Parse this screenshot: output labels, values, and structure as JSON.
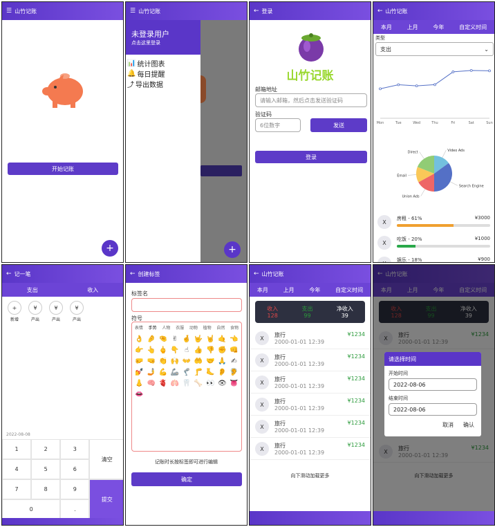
{
  "screen1": {
    "title": "山竹记账",
    "start_label": "开始记账",
    "fab": "+"
  },
  "screen2": {
    "title": "山竹记账",
    "user": "未登录用户",
    "hint": "点击这里登录",
    "menu": [
      {
        "label": "统计图表"
      },
      {
        "label": "每日提醒"
      },
      {
        "label": "导出数据"
      }
    ],
    "fab": "+"
  },
  "screen3": {
    "title": "登录",
    "brand": "山竹记账",
    "email_label": "邮箱地址",
    "email_placeholder": "请输入邮箱，然后点击发送验证码",
    "code_label": "验证码",
    "code_placeholder": "6位数字",
    "send_label": "发送",
    "login_label": "登录"
  },
  "screen4": {
    "title": "山竹记账",
    "tabs": [
      "本月",
      "上月",
      "今年",
      "自定义时间"
    ],
    "type_label": "类型",
    "type_value": "支出",
    "line": {
      "x": [
        "Mon",
        "Tue",
        "Wed",
        "Thu",
        "Fri",
        "Sat",
        "Sun"
      ],
      "y": [
        820,
        932,
        901,
        934,
        1290,
        1330,
        1320
      ]
    },
    "pie_labels": [
      "Video Ads",
      "Search Engine",
      "Union Ads",
      "Email",
      "Direct"
    ],
    "pie_values": [
      15,
      35,
      17,
      14,
      19
    ],
    "cats": [
      {
        "x": "X",
        "name": "房租 - 61%",
        "amount": "¥3000",
        "pct": 0.61,
        "color": "#f0a030"
      },
      {
        "x": "X",
        "name": "吃饭 - 20%",
        "amount": "¥1000",
        "pct": 0.2,
        "color": "#2aa84a"
      },
      {
        "x": "X",
        "name": "娱乐 - 18%",
        "amount": "¥900",
        "pct": 0.18,
        "color": "#3366cc"
      }
    ]
  },
  "screen5": {
    "title": "记一笔",
    "tabs": [
      "支出",
      "收入"
    ],
    "icons": [
      {
        "sym": "+",
        "label": "新增"
      },
      {
        "sym": "¥",
        "label": "产出"
      },
      {
        "sym": "¥",
        "label": "产出"
      },
      {
        "sym": "¥",
        "label": "产出"
      }
    ],
    "date": "2022-08-08",
    "keys": [
      "1",
      "2",
      "3",
      "4",
      "5",
      "6",
      "7",
      "8",
      "9",
      "0",
      "."
    ],
    "clear": "清空",
    "submit": "提交"
  },
  "screen6": {
    "title": "创建标签",
    "name_label": "标签名",
    "symbol_label": "符号",
    "cats": [
      "表情",
      "手势",
      "人物",
      "衣服",
      "动物",
      "植物",
      "自然",
      "食物"
    ],
    "emojis": [
      "👌",
      "🤌",
      "🤏",
      "✌",
      "🤞",
      "🤟",
      "🤘",
      "🤙",
      "👈",
      "👉",
      "👆",
      "🖕",
      "👇",
      "☝",
      "👍",
      "👎",
      "✊",
      "👊",
      "🤛",
      "🤜",
      "👏",
      "🙌",
      "👐",
      "🤲",
      "🤝",
      "🙏",
      "✍",
      "💅",
      "🤳",
      "💪",
      "🦾",
      "🦿",
      "🦵",
      "🦶",
      "👂",
      "🦻",
      "👃",
      "🧠",
      "🫀",
      "🫁",
      "🦷",
      "🦴",
      "👀",
      "👁",
      "👅",
      "👄"
    ],
    "tip": "记账时长按标签即可进行编辑",
    "confirm": "确定"
  },
  "screen7": {
    "title": "山竹记账",
    "tabs": [
      "本月",
      "上月",
      "今年",
      "自定义时间"
    ],
    "income_label": "收入",
    "income": "128",
    "expense_label": "支出",
    "expense": "99",
    "net_label": "净收入",
    "net": "39",
    "items": [
      {
        "x": "X",
        "name": "旅行",
        "date": "2000-01-01 12:39",
        "amount": "¥1234"
      },
      {
        "x": "X",
        "name": "旅行",
        "date": "2000-01-01 12:39",
        "amount": "¥1234"
      },
      {
        "x": "X",
        "name": "旅行",
        "date": "2000-01-01 12:39",
        "amount": "¥1234"
      },
      {
        "x": "X",
        "name": "旅行",
        "date": "2000-01-01 12:39",
        "amount": "¥1234"
      },
      {
        "x": "X",
        "name": "旅行",
        "date": "2000-01-01 12:39",
        "amount": "¥1234"
      },
      {
        "x": "X",
        "name": "旅行",
        "date": "2000-01-01 12:39",
        "amount": "¥1234"
      }
    ],
    "more": "向下滑动加载更多"
  },
  "screen8": {
    "title": "山竹记账",
    "tabs": [
      "本月",
      "上月",
      "今年",
      "自定义时间"
    ],
    "income_label": "收入",
    "income": "128",
    "expense_label": "支出",
    "expense": "99",
    "net_label": "净收入",
    "net": "39",
    "items": [
      {
        "x": "X",
        "name": "旅行",
        "date": "2000-01-01 12:39",
        "amount": "¥1234"
      },
      {
        "x": "X",
        "name": "旅行",
        "date": "2000-01-01 12:39",
        "amount": "¥1234"
      }
    ],
    "dialog": {
      "title": "请选择时间",
      "start_label": "开始时间",
      "start": "2022-08-06",
      "end_label": "结束时间",
      "end": "2022-08-06",
      "cancel": "取消",
      "ok": "确认"
    },
    "more": "向下滑动加载更多"
  },
  "colors": {
    "primary": "#5a36c8",
    "income": "#e04848",
    "expense": "#2a9a3a"
  }
}
